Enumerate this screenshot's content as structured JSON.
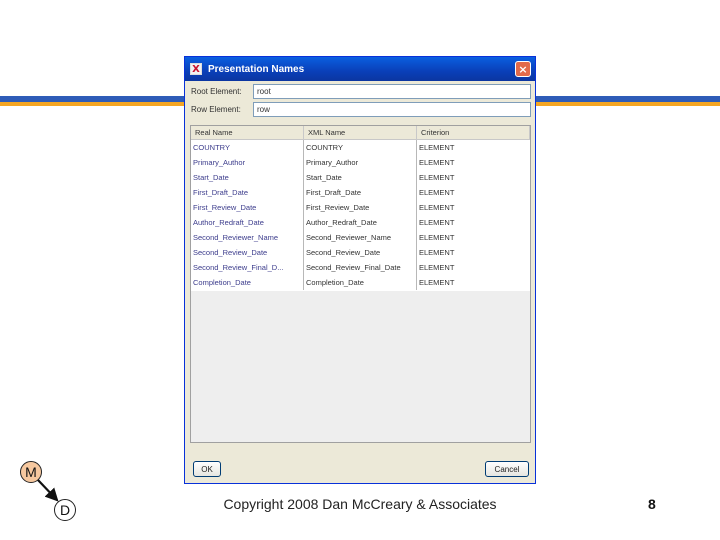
{
  "colors": {
    "band_blue": "#2e5cb8",
    "band_orange": "#f5a623",
    "titlebar_blue": "#0a4fd0",
    "logo_fill": "#f6c89f"
  },
  "dialog": {
    "title": "Presentation Names",
    "title_icon": "X",
    "close_glyph": "×",
    "fields": [
      {
        "label": "Root Element:",
        "value": "root"
      },
      {
        "label": "Row Element:",
        "value": "row"
      }
    ],
    "table": {
      "headers": [
        "Real Name",
        "XML Name",
        "Criterion"
      ],
      "rows": [
        [
          "COUNTRY",
          "COUNTRY",
          "ELEMENT"
        ],
        [
          "Primary_Author",
          "Primary_Author",
          "ELEMENT"
        ],
        [
          "Start_Date",
          "Start_Date",
          "ELEMENT"
        ],
        [
          "First_Draft_Date",
          "First_Draft_Date",
          "ELEMENT"
        ],
        [
          "First_Review_Date",
          "First_Review_Date",
          "ELEMENT"
        ],
        [
          "Author_Redraft_Date",
          "Author_Redraft_Date",
          "ELEMENT"
        ],
        [
          "Second_Reviewer_Name",
          "Second_Reviewer_Name",
          "ELEMENT"
        ],
        [
          "Second_Review_Date",
          "Second_Review_Date",
          "ELEMENT"
        ],
        [
          "Second_Review_Final_D...",
          "Second_Review_Final_Date",
          "ELEMENT"
        ],
        [
          "Completion_Date",
          "Completion_Date",
          "ELEMENT"
        ]
      ]
    },
    "ok_label": "OK",
    "cancel_label": "Cancel"
  },
  "footer": {
    "copyright": "Copyright 2008 Dan McCreary & Associates",
    "page_number": "8"
  },
  "logo": {
    "top_letter": "M",
    "bottom_letter": "D"
  }
}
